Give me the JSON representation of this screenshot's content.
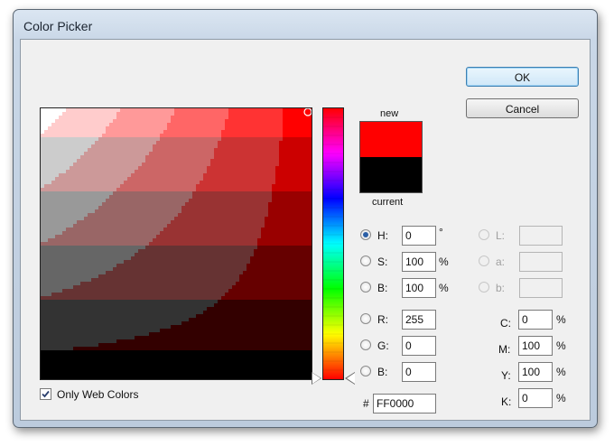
{
  "window": {
    "title": "Color Picker"
  },
  "colors": {
    "new": "#ff0000",
    "current": "#000000",
    "hue_cursor": "#ffffff"
  },
  "swatch": {
    "new_label": "new",
    "current_label": "current"
  },
  "buttons": {
    "ok": "OK",
    "cancel": "Cancel"
  },
  "hsb": [
    {
      "label": "H:",
      "value": "0",
      "unit": "°",
      "checked": true
    },
    {
      "label": "S:",
      "value": "100",
      "unit": "%",
      "checked": false
    },
    {
      "label": "B:",
      "value": "100",
      "unit": "%",
      "checked": false
    }
  ],
  "rgb": [
    {
      "label": "R:",
      "value": "255"
    },
    {
      "label": "G:",
      "value": "0"
    },
    {
      "label": "B:",
      "value": "0"
    }
  ],
  "lab": [
    {
      "label": "L:",
      "value": ""
    },
    {
      "label": "a:",
      "value": ""
    },
    {
      "label": "b:",
      "value": ""
    }
  ],
  "cmyk": [
    {
      "label": "C:",
      "value": "0",
      "unit": "%"
    },
    {
      "label": "M:",
      "value": "100",
      "unit": "%"
    },
    {
      "label": "Y:",
      "value": "100",
      "unit": "%"
    },
    {
      "label": "K:",
      "value": "0",
      "unit": "%"
    }
  ],
  "hex": {
    "label": "#",
    "value": "FF0000"
  },
  "web_colors": {
    "label": "Only Web Colors",
    "checked": true
  },
  "web_palette": {
    "levels": [
      "FF",
      "CC",
      "99",
      "66",
      "33",
      "00"
    ]
  },
  "hue_stops": [
    "#ff0000",
    "#ff00ff",
    "#0000ff",
    "#00ffff",
    "#00ff00",
    "#ffff00",
    "#ff0000"
  ]
}
